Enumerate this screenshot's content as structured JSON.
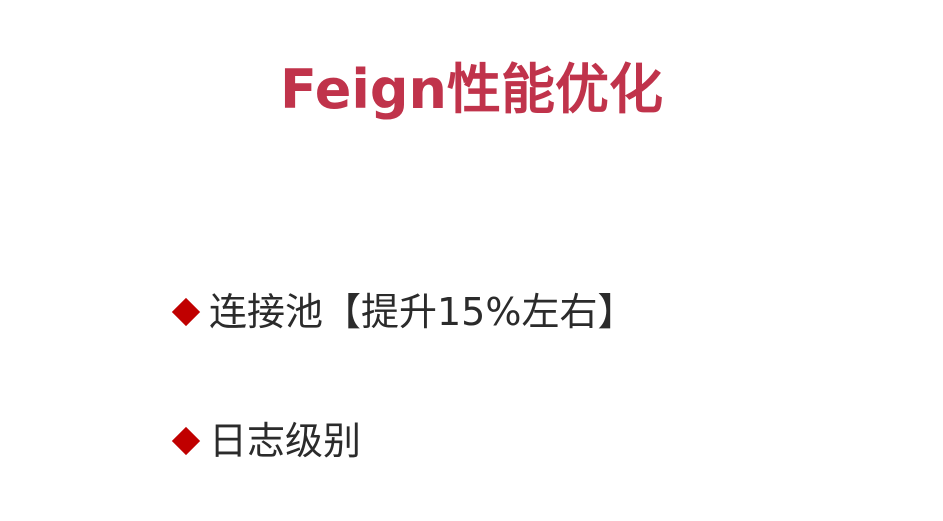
{
  "slide": {
    "title": "Feign性能优化",
    "title_color": "#c0334b",
    "bullet_color": "#c00000",
    "bullets": [
      {
        "icon": "diamond-bullet-icon",
        "text": "连接池【提升15%左右】"
      },
      {
        "icon": "diamond-bullet-icon",
        "text": "日志级别"
      }
    ]
  }
}
